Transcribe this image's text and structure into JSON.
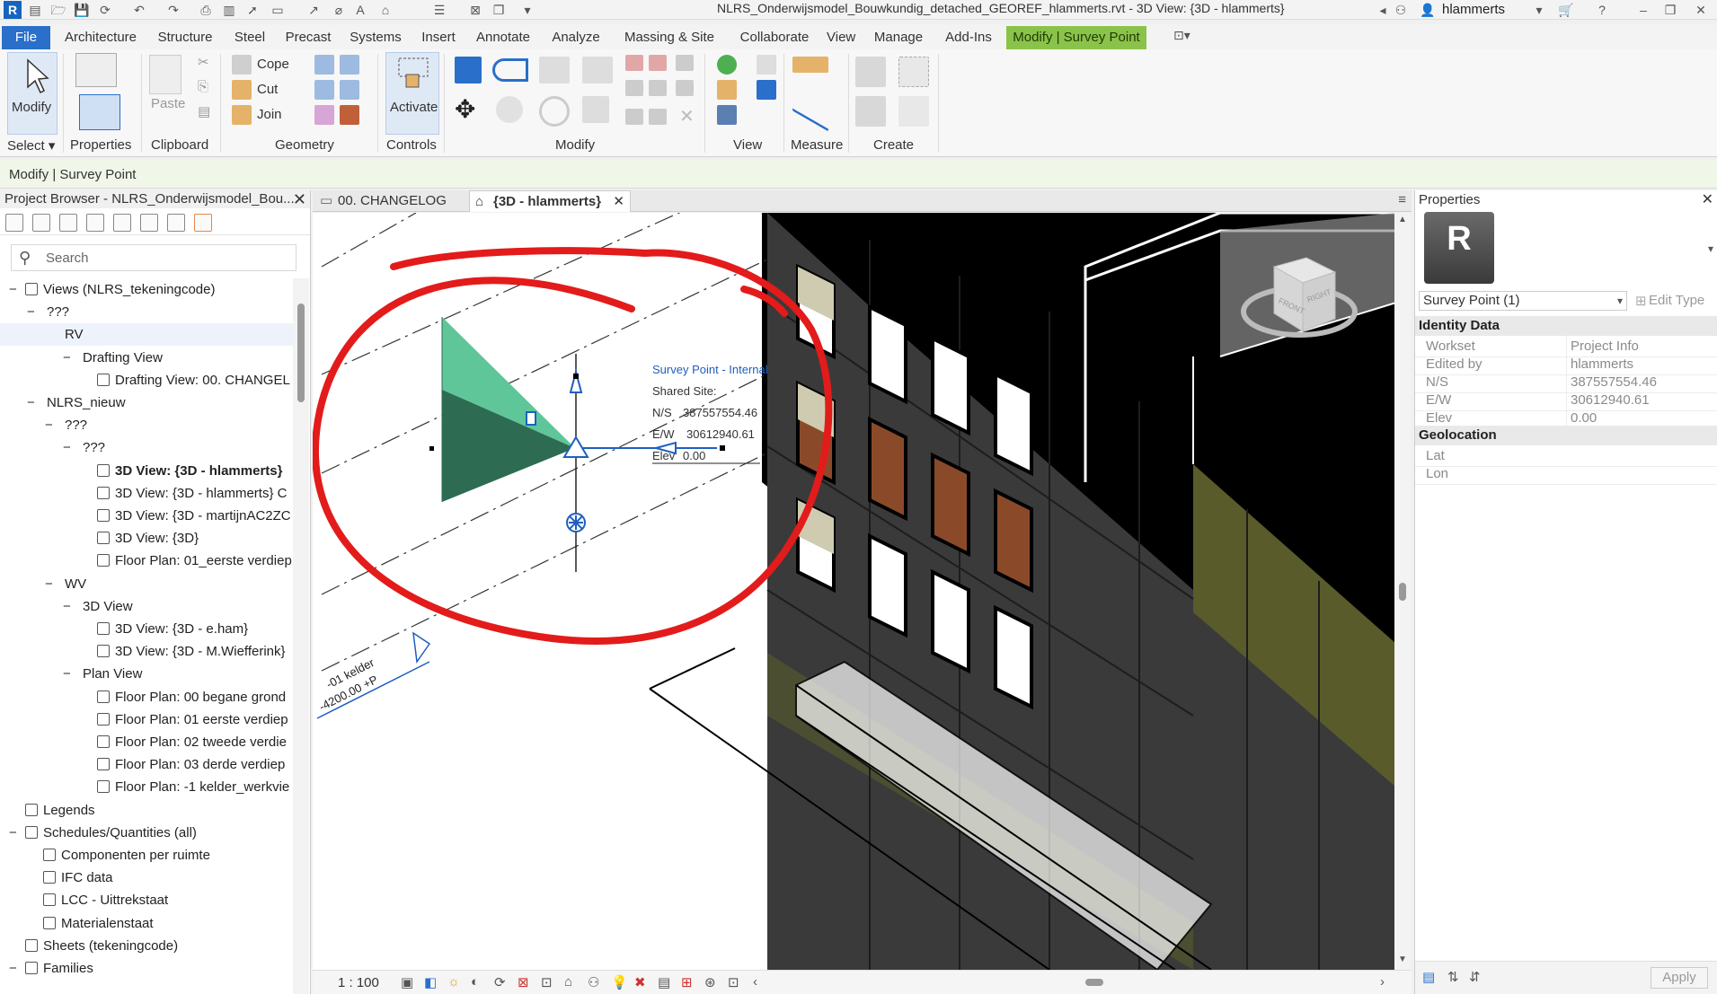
{
  "app": {
    "logo_letter": "R",
    "title": "NLRS_Onderwijsmodel_Bouwkundig_detached_GEOREF_hlammerts.rvt - 3D View: {3D - hlammerts}",
    "user": "hlammerts"
  },
  "ribbon_tabs": [
    "File",
    "Architecture",
    "Structure",
    "Steel",
    "Precast",
    "Systems",
    "Insert",
    "Annotate",
    "Analyze",
    "Massing & Site",
    "Collaborate",
    "View",
    "Manage",
    "Add-Ins",
    "Modify | Survey Point"
  ],
  "ribbon": {
    "modify_label": "Modify",
    "paste_label": "Paste",
    "cope_label": "Cope",
    "cut_label": "Cut",
    "join_label": "Join",
    "activate_label": "Activate",
    "panels": {
      "select": "Select",
      "properties": "Properties",
      "clipboard": "Clipboard",
      "geometry": "Geometry",
      "controls": "Controls",
      "modify": "Modify",
      "view": "View",
      "measure": "Measure",
      "create": "Create"
    }
  },
  "options_bar": {
    "context": "Modify | Survey Point"
  },
  "project_browser": {
    "title": "Project Browser - NLRS_Onderwijsmodel_Bou...",
    "search_placeholder": "Search",
    "tree": [
      {
        "label": "Views (NLRS_tekeningcode)",
        "level": 0,
        "toggle": "−",
        "icon": "views"
      },
      {
        "label": "???",
        "level": 1,
        "toggle": "−"
      },
      {
        "label": "RV",
        "level": 2,
        "toggle": ""
      },
      {
        "label": "Drafting View",
        "level": 3,
        "toggle": "−"
      },
      {
        "label": "Drafting View: 00. CHANGEL",
        "level": 4,
        "icon": "view"
      },
      {
        "label": "NLRS_nieuw",
        "level": 1,
        "toggle": "−"
      },
      {
        "label": "???",
        "level": 2,
        "toggle": "−"
      },
      {
        "label": "???",
        "level": 3,
        "toggle": "−"
      },
      {
        "label": "3D View: {3D - hlammerts}",
        "level": 4,
        "icon": "view",
        "bold": true
      },
      {
        "label": "3D View: {3D - hlammerts} C",
        "level": 4,
        "icon": "view"
      },
      {
        "label": "3D View: {3D - martijnAC2ZC",
        "level": 4,
        "icon": "view"
      },
      {
        "label": "3D View: {3D}",
        "level": 4,
        "icon": "view"
      },
      {
        "label": "Floor Plan: 01_eerste verdiep",
        "level": 4,
        "icon": "view"
      },
      {
        "label": "WV",
        "level": 2,
        "toggle": "−"
      },
      {
        "label": "3D View",
        "level": 3,
        "toggle": "−"
      },
      {
        "label": "3D View: {3D - e.ham}",
        "level": 4,
        "icon": "view"
      },
      {
        "label": "3D View: {3D - M.Wiefferink}",
        "level": 4,
        "icon": "view"
      },
      {
        "label": "Plan View",
        "level": 3,
        "toggle": "−"
      },
      {
        "label": "Floor Plan: 00 begane grond",
        "level": 4,
        "icon": "view"
      },
      {
        "label": "Floor Plan: 01 eerste verdiep",
        "level": 4,
        "icon": "view"
      },
      {
        "label": "Floor Plan: 02 tweede verdie",
        "level": 4,
        "icon": "view"
      },
      {
        "label": "Floor Plan: 03 derde verdiep",
        "level": 4,
        "icon": "view"
      },
      {
        "label": "Floor Plan: -1 kelder_werkvie",
        "level": 4,
        "icon": "view"
      },
      {
        "label": "Legends",
        "level": 0,
        "toggle": "",
        "icon": "legend"
      },
      {
        "label": "Schedules/Quantities (all)",
        "level": 0,
        "toggle": "−",
        "icon": "schedule"
      },
      {
        "label": "Componenten per ruimte",
        "level": 1,
        "icon": "view"
      },
      {
        "label": "IFC data",
        "level": 1,
        "icon": "view"
      },
      {
        "label": "LCC - Uittrekstaat",
        "level": 1,
        "icon": "view"
      },
      {
        "label": "Materialenstaat",
        "level": 1,
        "icon": "view"
      },
      {
        "label": "Sheets (tekeningcode)",
        "level": 0,
        "toggle": "",
        "icon": "sheet"
      },
      {
        "label": "Families",
        "level": 0,
        "toggle": "−",
        "icon": "family"
      }
    ]
  },
  "view_tabs": [
    {
      "label": "00. CHANGELOG",
      "active": false
    },
    {
      "label": "{3D - hlammerts}",
      "active": true
    }
  ],
  "viewport": {
    "survey_point_label": "Survey Point - Internal",
    "shared_site_label": "Shared Site:",
    "ns_label": "N/S",
    "ns_value": "387557554.46",
    "ew_label": "E/W",
    "ew_value": "30612940.61",
    "elev_label": "Elev",
    "elev_value": "0.00",
    "level_name": "-01 kelder",
    "level_elev": "-4200.00 +P",
    "viewcube_front": "FRONT",
    "viewcube_right": "RIGHT"
  },
  "view_status": {
    "scale": "1 : 100"
  },
  "properties": {
    "title": "Properties",
    "type_selector": "Survey Point (1)",
    "edit_type": "Edit Type",
    "sections": [
      {
        "name": "Identity Data",
        "rows": [
          {
            "label": "Workset",
            "value": "Project Info"
          },
          {
            "label": "Edited by",
            "value": "hlammerts"
          },
          {
            "label": "N/S",
            "value": "387557554.46"
          },
          {
            "label": "E/W",
            "value": "30612940.61"
          },
          {
            "label": "Elev",
            "value": "0.00"
          }
        ]
      },
      {
        "name": "Geolocation",
        "rows": [
          {
            "label": "Lat",
            "value": ""
          },
          {
            "label": "Lon",
            "value": ""
          }
        ]
      }
    ],
    "apply_label": "Apply"
  },
  "colors": {
    "file_tab": "#2a6fc9",
    "context_tab": "#8bc34a",
    "markup_circle": "#e31b1b",
    "survey_triangle_light": "#5fc69a",
    "survey_triangle_dark": "#2d6b52",
    "gizmo_blue": "#1f5fbf",
    "facade": "#3a3a3a",
    "wall_band": "#595b2b",
    "window_frame": "#000000",
    "panel_brown": "#8a4a2a"
  }
}
